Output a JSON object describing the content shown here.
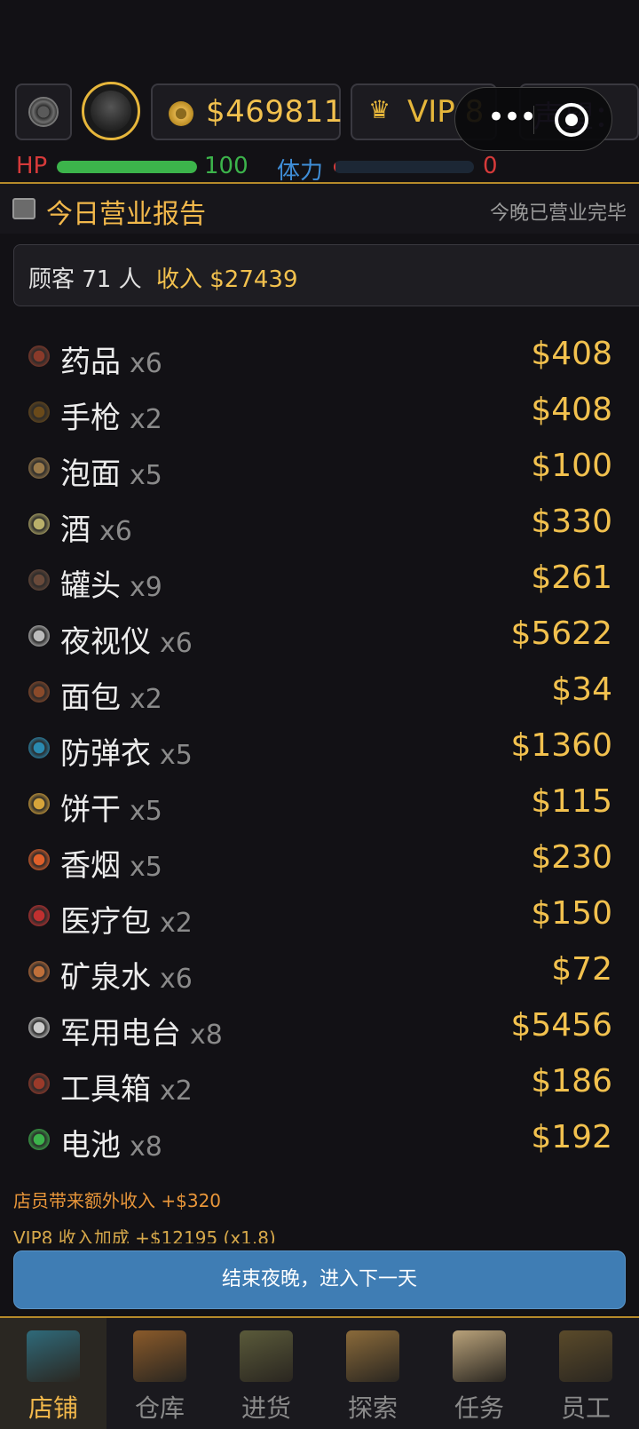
{
  "hud": {
    "money": "$469811",
    "vip": "VIP 8",
    "reputation": "声望：4"
  },
  "stats": {
    "hp_label": "HP",
    "hp_value": "100",
    "hp_fill": 1.0,
    "stamina_label": "体力",
    "stamina_value": "0",
    "stamina_fill": 0.0
  },
  "report": {
    "title": "今日营业报告",
    "status": "今晚已营业完毕",
    "customers": "顾客 71 人",
    "income": "收入 $27439"
  },
  "items": [
    {
      "name": "药品",
      "qty": "x6",
      "price": "$408",
      "icon": "medicine-icon",
      "color": "#8a3a2a"
    },
    {
      "name": "手枪",
      "qty": "x2",
      "price": "$408",
      "icon": "pistol-icon",
      "color": "#6a4a1a"
    },
    {
      "name": "泡面",
      "qty": "x5",
      "price": "$100",
      "icon": "noodles-icon",
      "color": "#9a7a4a"
    },
    {
      "name": "酒",
      "qty": "x6",
      "price": "$330",
      "icon": "liquor-icon",
      "color": "#b9b06a"
    },
    {
      "name": "罐头",
      "qty": "x9",
      "price": "$261",
      "icon": "canned-food-icon",
      "color": "#6a4a3a"
    },
    {
      "name": "夜视仪",
      "qty": "x6",
      "price": "$5622",
      "icon": "night-vision-icon",
      "color": "#bbbbbb"
    },
    {
      "name": "面包",
      "qty": "x2",
      "price": "$34",
      "icon": "bread-icon",
      "color": "#8a4a2a"
    },
    {
      "name": "防弹衣",
      "qty": "x5",
      "price": "$1360",
      "icon": "body-armor-icon",
      "color": "#2a8ab0"
    },
    {
      "name": "饼干",
      "qty": "x5",
      "price": "$115",
      "icon": "biscuit-icon",
      "color": "#d6a43a"
    },
    {
      "name": "香烟",
      "qty": "x5",
      "price": "$230",
      "icon": "cigarette-icon",
      "color": "#e0602a"
    },
    {
      "name": "医疗包",
      "qty": "x2",
      "price": "$150",
      "icon": "medkit-icon",
      "color": "#c03030"
    },
    {
      "name": "矿泉水",
      "qty": "x6",
      "price": "$72",
      "icon": "water-icon",
      "color": "#c0703a"
    },
    {
      "name": "军用电台",
      "qty": "x8",
      "price": "$5456",
      "icon": "radio-icon",
      "color": "#cccccc"
    },
    {
      "name": "工具箱",
      "qty": "x2",
      "price": "$186",
      "icon": "toolbox-icon",
      "color": "#9a3a2a"
    },
    {
      "name": "电池",
      "qty": "x8",
      "price": "$192",
      "icon": "battery-icon",
      "color": "#3cb44b"
    }
  ],
  "notes": {
    "staff_bonus": "店员带来额外收入 +$320",
    "vip_bonus": "VIP8 收入加成 +$12195 (x1.8)"
  },
  "end_button": "结束夜晚，进入下一天",
  "nav": [
    {
      "label": "店铺",
      "icon": "shop-icon",
      "active": true
    },
    {
      "label": "仓库",
      "icon": "warehouse-icon",
      "active": false
    },
    {
      "label": "进货",
      "icon": "restock-truck-icon",
      "active": false
    },
    {
      "label": "探索",
      "icon": "explore-map-icon",
      "active": false
    },
    {
      "label": "任务",
      "icon": "tasks-clipboard-icon",
      "active": false
    },
    {
      "label": "员工",
      "icon": "staff-icon",
      "active": false
    }
  ],
  "colors": {
    "accent_gold": "#f2c14e",
    "hp_green": "#3cb44b",
    "stamina_blue": "#3f8ed8",
    "button_blue": "#3f7db4"
  }
}
